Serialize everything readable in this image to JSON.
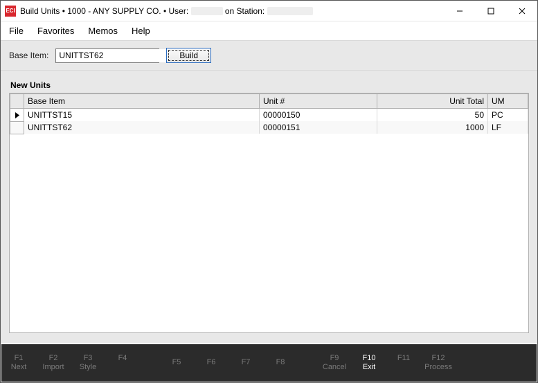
{
  "title": {
    "app_icon": "ECI",
    "prefix": "Build Units  •  ",
    "company": "1000 - ANY SUPPLY CO.",
    "user_label": "  •   User: ",
    "station_label": " on Station: "
  },
  "menus": {
    "file": "File",
    "favorites": "Favorites",
    "memos": "Memos",
    "help": "Help"
  },
  "toolbar": {
    "base_item_label": "Base Item:",
    "base_item_value": "UNITTST62",
    "build_label": "Build"
  },
  "section": {
    "new_units": "New Units"
  },
  "columns": {
    "base_item": "Base Item",
    "unit_no": "Unit #",
    "unit_total": "Unit Total",
    "um": "UM"
  },
  "rows": [
    {
      "selected": true,
      "base_item": "UNITTST15",
      "unit_no": "00000150",
      "unit_total": "50",
      "um": "PC"
    },
    {
      "selected": false,
      "base_item": "UNITTST62",
      "unit_no": "00000151",
      "unit_total": "1000",
      "um": "LF"
    }
  ],
  "fkeys": [
    {
      "key": "F1",
      "label": "Next",
      "active": false
    },
    {
      "key": "F2",
      "label": "Import",
      "active": false
    },
    {
      "key": "F3",
      "label": "Style",
      "active": false
    },
    {
      "key": "F4",
      "label": "",
      "active": false
    },
    {
      "key": "F5",
      "label": "",
      "active": false
    },
    {
      "key": "F6",
      "label": "",
      "active": false
    },
    {
      "key": "F7",
      "label": "",
      "active": false
    },
    {
      "key": "F8",
      "label": "",
      "active": false
    },
    {
      "key": "F9",
      "label": "Cancel",
      "active": false
    },
    {
      "key": "F10",
      "label": "Exit",
      "active": true
    },
    {
      "key": "F11",
      "label": "",
      "active": false
    },
    {
      "key": "F12",
      "label": "Process",
      "active": false
    }
  ]
}
